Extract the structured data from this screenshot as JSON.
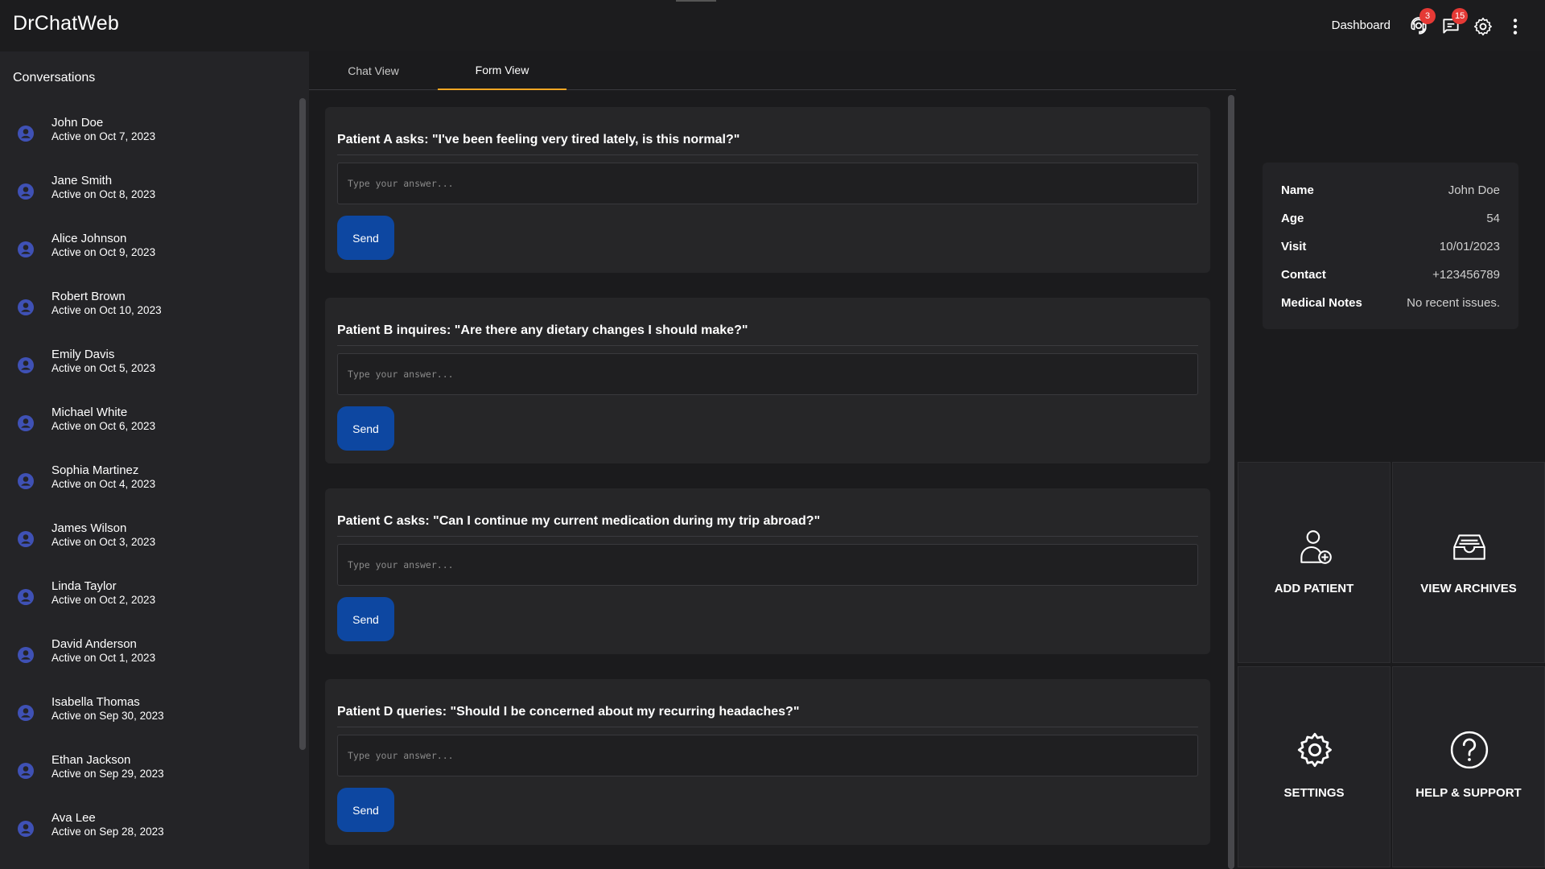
{
  "app": {
    "title": "DrChatWeb"
  },
  "header": {
    "dashboard_label": "Dashboard",
    "badges": {
      "support": "3",
      "messages": "15"
    },
    "icons": [
      "support-agent-icon",
      "chat-bubble-icon",
      "gear-icon",
      "more-vert-icon"
    ]
  },
  "sidebar": {
    "title": "Conversations",
    "items": [
      {
        "name": "John Doe",
        "date": "Active on Oct 7, 2023"
      },
      {
        "name": "Jane Smith",
        "date": "Active on Oct 8, 2023"
      },
      {
        "name": "Alice Johnson",
        "date": "Active on Oct 9, 2023"
      },
      {
        "name": "Robert Brown",
        "date": "Active on Oct 10, 2023"
      },
      {
        "name": "Emily Davis",
        "date": "Active on Oct 5, 2023"
      },
      {
        "name": "Michael White",
        "date": "Active on Oct 6, 2023"
      },
      {
        "name": "Sophia Martinez",
        "date": "Active on Oct 4, 2023"
      },
      {
        "name": "James Wilson",
        "date": "Active on Oct 3, 2023"
      },
      {
        "name": "Linda Taylor",
        "date": "Active on Oct 2, 2023"
      },
      {
        "name": "David Anderson",
        "date": "Active on Oct 1, 2023"
      },
      {
        "name": "Isabella Thomas",
        "date": "Active on Sep 30, 2023"
      },
      {
        "name": "Ethan Jackson",
        "date": "Active on Sep 29, 2023"
      },
      {
        "name": "Ava Lee",
        "date": "Active on Sep 28, 2023"
      }
    ]
  },
  "tabs": [
    {
      "label": "Chat View"
    },
    {
      "label": "Form View"
    }
  ],
  "form": {
    "questions": [
      {
        "text": "Patient A asks: \"I've been feeling very tired lately, is this normal?\"",
        "placeholder": "Type your answer...",
        "button": "Send"
      },
      {
        "text": "Patient B inquires: \"Are there any dietary changes I should make?\"",
        "placeholder": "Type your answer...",
        "button": "Send"
      },
      {
        "text": "Patient C asks: \"Can I continue my current medication during my trip abroad?\"",
        "placeholder": "Type your answer...",
        "button": "Send"
      },
      {
        "text": "Patient D queries: \"Should I be concerned about my recurring headaches?\"",
        "placeholder": "Type your answer...",
        "button": "Send"
      }
    ]
  },
  "patient": {
    "rows": [
      {
        "key": "Name",
        "value": "John Doe"
      },
      {
        "key": "Age",
        "value": "54"
      },
      {
        "key": "Visit",
        "value": "10/01/2023"
      },
      {
        "key": "Contact",
        "value": "+123456789"
      },
      {
        "key": "Medical Notes",
        "value": "No recent issues."
      }
    ]
  },
  "actions": [
    {
      "label": "ADD PATIENT",
      "icon": "add-user-icon"
    },
    {
      "label": "VIEW ARCHIVES",
      "icon": "archive-icon"
    },
    {
      "label": "SETTINGS",
      "icon": "gear-icon"
    },
    {
      "label": "HELP & SUPPORT",
      "icon": "help-icon"
    }
  ],
  "colors": {
    "accent": "#f5a623",
    "button": "#0d47a1",
    "avatar": "#3f51b5",
    "badge": "#e53935"
  }
}
